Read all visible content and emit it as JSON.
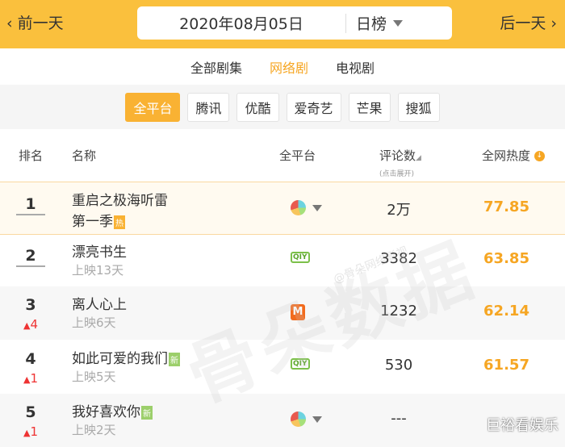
{
  "header": {
    "prev": "前一天",
    "next": "后一天",
    "date": "2020年08月05日",
    "rank_type": "日榜"
  },
  "tabs": [
    {
      "label": "全部剧集"
    },
    {
      "label": "网络剧"
    },
    {
      "label": "电视剧"
    }
  ],
  "platforms": [
    "全平台",
    "腾讯",
    "优酷",
    "爱奇艺",
    "芒果",
    "搜狐"
  ],
  "columns": {
    "rank": "排名",
    "name": "名称",
    "platform": "全平台",
    "comments": "评论数",
    "comments_hint": "(点击展开)",
    "heat": "全网热度"
  },
  "rows": [
    {
      "rank": "1",
      "change": "",
      "name": "重启之极海听雷",
      "line2": "第一季",
      "badge": "热",
      "platform": "multi",
      "comments": "2万",
      "heat": "77.85"
    },
    {
      "rank": "2",
      "change": "",
      "name": "漂亮书生",
      "line2": "上映13天",
      "badge": "",
      "platform": "iqiyi",
      "comments": "3382",
      "heat": "63.85"
    },
    {
      "rank": "3",
      "change": "4",
      "name": "离人心上",
      "line2": "上映6天",
      "badge": "",
      "platform": "mango",
      "comments": "1232",
      "heat": "62.14"
    },
    {
      "rank": "4",
      "change": "1",
      "name": "如此可爱的我们",
      "line2": "上映5天",
      "badge": "新",
      "platform": "iqiyi",
      "comments": "530",
      "heat": "61.57"
    },
    {
      "rank": "5",
      "change": "1",
      "name": "我好喜欢你",
      "line2": "上映2天",
      "badge": "新",
      "platform": "multi",
      "comments": "---",
      "heat": ""
    }
  ],
  "icons": {
    "iqiyi": "QIY",
    "mango": "M"
  },
  "watermark": "骨朵数据",
  "watermark_sub": "@骨朵网络影视",
  "corner_mark": "巨裕看娱乐"
}
